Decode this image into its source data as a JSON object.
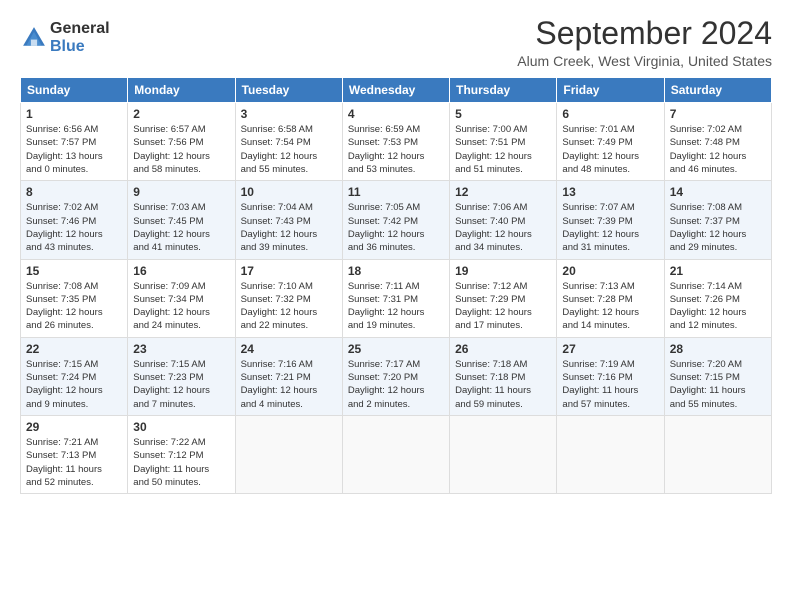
{
  "header": {
    "logo_line1": "General",
    "logo_line2": "Blue",
    "month": "September 2024",
    "location": "Alum Creek, West Virginia, United States"
  },
  "days_of_week": [
    "Sunday",
    "Monday",
    "Tuesday",
    "Wednesday",
    "Thursday",
    "Friday",
    "Saturday"
  ],
  "weeks": [
    [
      {
        "day": "1",
        "info": "Sunrise: 6:56 AM\nSunset: 7:57 PM\nDaylight: 13 hours\nand 0 minutes."
      },
      {
        "day": "2",
        "info": "Sunrise: 6:57 AM\nSunset: 7:56 PM\nDaylight: 12 hours\nand 58 minutes."
      },
      {
        "day": "3",
        "info": "Sunrise: 6:58 AM\nSunset: 7:54 PM\nDaylight: 12 hours\nand 55 minutes."
      },
      {
        "day": "4",
        "info": "Sunrise: 6:59 AM\nSunset: 7:53 PM\nDaylight: 12 hours\nand 53 minutes."
      },
      {
        "day": "5",
        "info": "Sunrise: 7:00 AM\nSunset: 7:51 PM\nDaylight: 12 hours\nand 51 minutes."
      },
      {
        "day": "6",
        "info": "Sunrise: 7:01 AM\nSunset: 7:49 PM\nDaylight: 12 hours\nand 48 minutes."
      },
      {
        "day": "7",
        "info": "Sunrise: 7:02 AM\nSunset: 7:48 PM\nDaylight: 12 hours\nand 46 minutes."
      }
    ],
    [
      {
        "day": "8",
        "info": "Sunrise: 7:02 AM\nSunset: 7:46 PM\nDaylight: 12 hours\nand 43 minutes."
      },
      {
        "day": "9",
        "info": "Sunrise: 7:03 AM\nSunset: 7:45 PM\nDaylight: 12 hours\nand 41 minutes."
      },
      {
        "day": "10",
        "info": "Sunrise: 7:04 AM\nSunset: 7:43 PM\nDaylight: 12 hours\nand 39 minutes."
      },
      {
        "day": "11",
        "info": "Sunrise: 7:05 AM\nSunset: 7:42 PM\nDaylight: 12 hours\nand 36 minutes."
      },
      {
        "day": "12",
        "info": "Sunrise: 7:06 AM\nSunset: 7:40 PM\nDaylight: 12 hours\nand 34 minutes."
      },
      {
        "day": "13",
        "info": "Sunrise: 7:07 AM\nSunset: 7:39 PM\nDaylight: 12 hours\nand 31 minutes."
      },
      {
        "day": "14",
        "info": "Sunrise: 7:08 AM\nSunset: 7:37 PM\nDaylight: 12 hours\nand 29 minutes."
      }
    ],
    [
      {
        "day": "15",
        "info": "Sunrise: 7:08 AM\nSunset: 7:35 PM\nDaylight: 12 hours\nand 26 minutes."
      },
      {
        "day": "16",
        "info": "Sunrise: 7:09 AM\nSunset: 7:34 PM\nDaylight: 12 hours\nand 24 minutes."
      },
      {
        "day": "17",
        "info": "Sunrise: 7:10 AM\nSunset: 7:32 PM\nDaylight: 12 hours\nand 22 minutes."
      },
      {
        "day": "18",
        "info": "Sunrise: 7:11 AM\nSunset: 7:31 PM\nDaylight: 12 hours\nand 19 minutes."
      },
      {
        "day": "19",
        "info": "Sunrise: 7:12 AM\nSunset: 7:29 PM\nDaylight: 12 hours\nand 17 minutes."
      },
      {
        "day": "20",
        "info": "Sunrise: 7:13 AM\nSunset: 7:28 PM\nDaylight: 12 hours\nand 14 minutes."
      },
      {
        "day": "21",
        "info": "Sunrise: 7:14 AM\nSunset: 7:26 PM\nDaylight: 12 hours\nand 12 minutes."
      }
    ],
    [
      {
        "day": "22",
        "info": "Sunrise: 7:15 AM\nSunset: 7:24 PM\nDaylight: 12 hours\nand 9 minutes."
      },
      {
        "day": "23",
        "info": "Sunrise: 7:15 AM\nSunset: 7:23 PM\nDaylight: 12 hours\nand 7 minutes."
      },
      {
        "day": "24",
        "info": "Sunrise: 7:16 AM\nSunset: 7:21 PM\nDaylight: 12 hours\nand 4 minutes."
      },
      {
        "day": "25",
        "info": "Sunrise: 7:17 AM\nSunset: 7:20 PM\nDaylight: 12 hours\nand 2 minutes."
      },
      {
        "day": "26",
        "info": "Sunrise: 7:18 AM\nSunset: 7:18 PM\nDaylight: 11 hours\nand 59 minutes."
      },
      {
        "day": "27",
        "info": "Sunrise: 7:19 AM\nSunset: 7:16 PM\nDaylight: 11 hours\nand 57 minutes."
      },
      {
        "day": "28",
        "info": "Sunrise: 7:20 AM\nSunset: 7:15 PM\nDaylight: 11 hours\nand 55 minutes."
      }
    ],
    [
      {
        "day": "29",
        "info": "Sunrise: 7:21 AM\nSunset: 7:13 PM\nDaylight: 11 hours\nand 52 minutes."
      },
      {
        "day": "30",
        "info": "Sunrise: 7:22 AM\nSunset: 7:12 PM\nDaylight: 11 hours\nand 50 minutes."
      },
      {
        "day": "",
        "info": ""
      },
      {
        "day": "",
        "info": ""
      },
      {
        "day": "",
        "info": ""
      },
      {
        "day": "",
        "info": ""
      },
      {
        "day": "",
        "info": ""
      }
    ]
  ]
}
